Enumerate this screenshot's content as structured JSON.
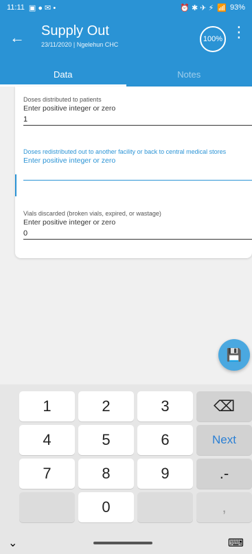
{
  "status": {
    "time": "11:11",
    "left_icons": "▣ ● ✉ •",
    "right_icons": "⏰ ✱ ✈ ⚡",
    "signal": "📶",
    "battery": "93%"
  },
  "appbar": {
    "back": "←",
    "title": "Supply Out",
    "subtitle": "23/11/2020 | Ngelehun CHC",
    "progress": "100%",
    "more": "⋮"
  },
  "tabs": [
    {
      "label": "Data",
      "active": true
    },
    {
      "label": "Notes",
      "active": false
    }
  ],
  "form": {
    "field1": {
      "label": "Doses distributed to patients",
      "hint": "Enter positive integer or zero",
      "value": "1"
    },
    "field2": {
      "label": "Doses redistributed out to another facility or back to central medical stores",
      "hint": "Enter positive integer or zero",
      "value": ""
    },
    "field3": {
      "label": "Vials discarded (broken vials, expired, or wastage)",
      "hint": "Enter positive integer or zero",
      "value": "0"
    }
  },
  "fab": {
    "icon": "💾"
  },
  "keyboard": {
    "row1": [
      "1",
      "2",
      "3",
      "⌫"
    ],
    "row2": [
      "4",
      "5",
      "6",
      "Next"
    ],
    "row3": [
      "7",
      "8",
      "9",
      ".-"
    ],
    "row4": [
      "",
      "0",
      "",
      ","
    ]
  },
  "navbar": {
    "chevron": "⌄",
    "keyboard_icon": "⌨"
  }
}
